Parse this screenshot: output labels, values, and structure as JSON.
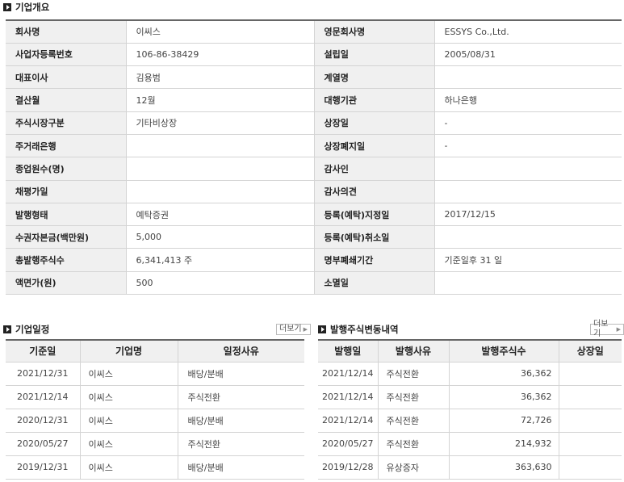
{
  "overview": {
    "title": "기업개요",
    "rows": [
      {
        "l1": "회사명",
        "v1": "이씨스",
        "l2": "영문회사명",
        "v2": "ESSYS Co.,Ltd."
      },
      {
        "l1": "사업자등록번호",
        "v1": "106-86-38429",
        "l2": "설립일",
        "v2": "2005/08/31"
      },
      {
        "l1": "대표이사",
        "v1": "김용범",
        "l2": "계열명",
        "v2": ""
      },
      {
        "l1": "결산월",
        "v1": "12월",
        "l2": "대행기관",
        "v2": "하나은행"
      },
      {
        "l1": "주식시장구분",
        "v1": "기타비상장",
        "l2": "상장일",
        "v2": "-"
      },
      {
        "l1": "주거래은행",
        "v1": "",
        "l2": "상장폐지일",
        "v2": "-"
      },
      {
        "l1": "종업원수(명)",
        "v1": "",
        "l2": "감사인",
        "v2": ""
      },
      {
        "l1": "채평가일",
        "v1": "",
        "l2": "감사의견",
        "v2": ""
      },
      {
        "l1": "발행형태",
        "v1": "예탁증권",
        "l2": "등록(예탁)지정일",
        "v2": "2017/12/15"
      },
      {
        "l1": "수권자본금(백만원)",
        "v1": "5,000",
        "l2": "등록(예탁)취소일",
        "v2": ""
      },
      {
        "l1": "총발행주식수",
        "v1": "6,341,413 주",
        "l2": "명부폐쇄기간",
        "v2": "기준일후 31 일"
      },
      {
        "l1": "액면가(원)",
        "v1": "500",
        "l2": "소멸일",
        "v2": ""
      }
    ]
  },
  "schedule": {
    "title": "기업일정",
    "more_label": "더보기",
    "headers": [
      "기준일",
      "기업명",
      "일정사유"
    ],
    "rows": [
      [
        "2021/12/31",
        "이씨스",
        "배당/분배"
      ],
      [
        "2021/12/14",
        "이씨스",
        "주식전환"
      ],
      [
        "2020/12/31",
        "이씨스",
        "배당/분배"
      ],
      [
        "2020/05/27",
        "이씨스",
        "주식전환"
      ],
      [
        "2019/12/31",
        "이씨스",
        "배당/분배"
      ]
    ]
  },
  "shares": {
    "title": "발행주식변동내역",
    "more_label": "더보기",
    "headers": [
      "발행일",
      "발행사유",
      "발행주식수",
      "상장일"
    ],
    "rows": [
      [
        "2021/12/14",
        "주식전환",
        "36,362",
        ""
      ],
      [
        "2021/12/14",
        "주식전환",
        "36,362",
        ""
      ],
      [
        "2021/12/14",
        "주식전환",
        "72,726",
        ""
      ],
      [
        "2020/05/27",
        "주식전환",
        "214,932",
        ""
      ],
      [
        "2019/12/28",
        "유상증자",
        "363,630",
        ""
      ]
    ]
  }
}
